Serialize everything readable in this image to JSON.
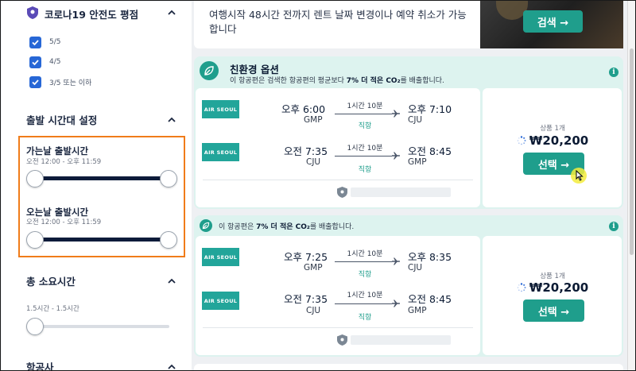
{
  "sidebar": {
    "covid_rating": {
      "title": "코로나19 안전도 평점",
      "options": [
        {
          "label": "5/5",
          "checked": true
        },
        {
          "label": "4/5",
          "checked": true
        },
        {
          "label": "3/5 또는 이하",
          "checked": true
        }
      ]
    },
    "departure_time": {
      "title": "출발 시간대 설정",
      "outbound": {
        "title": "가는날 출발시간",
        "range": "오전 12:00 - 오후 11:59"
      },
      "return": {
        "title": "오는날 출발시간",
        "range": "오전 12:00 - 오후 11:59"
      }
    },
    "duration": {
      "title": "총 소요시간",
      "range": "1.5시간 - 1.5시간"
    },
    "airline": {
      "title": "항공사"
    }
  },
  "top_card": {
    "text": "여행시작 48시간 전까지 렌트 날짜 변경이나 예약 취소가 가능합니다",
    "search_label": "검색 →"
  },
  "results": [
    {
      "eco_title": "친환경 옵션",
      "eco_desc_pre": "이 항공편은 검색한 항공편의 평균보다 ",
      "eco_desc_bold": "7% 더 적은 CO₂",
      "eco_desc_post": "를 배출합니다.",
      "legs": [
        {
          "airline": "AIR SEOUL",
          "dep_time": "오후 6:00",
          "dep_code": "GMP",
          "duration": "1시간 10분",
          "stops": "직항",
          "arr_time": "오후 7:10",
          "arr_code": "CJU"
        },
        {
          "airline": "AIR SEOUL",
          "dep_time": "오전 7:35",
          "dep_code": "CJU",
          "duration": "1시간 10분",
          "stops": "직항",
          "arr_time": "오전 8:45",
          "arr_code": "GMP"
        }
      ],
      "offer_count": "상품 1개",
      "price": "₩20,200",
      "select_label": "선택 →"
    },
    {
      "eco_desc_pre": "이 항공편은 ",
      "eco_desc_bold": "7% 더 적은 CO₂",
      "eco_desc_post": "를 배출합니다.",
      "legs": [
        {
          "airline": "AIR SEOUL",
          "dep_time": "오후 7:25",
          "dep_code": "GMP",
          "duration": "1시간 10분",
          "stops": "직항",
          "arr_time": "오후 8:35",
          "arr_code": "CJU"
        },
        {
          "airline": "AIR SEOUL",
          "dep_time": "오전 7:35",
          "dep_code": "CJU",
          "duration": "1시간 10분",
          "stops": "직항",
          "arr_time": "오전 8:45",
          "arr_code": "GMP"
        }
      ],
      "offer_count": "상품 1개",
      "price": "₩20,200",
      "select_label": "선택 →"
    }
  ],
  "colors": {
    "accent": "#1f9e8c",
    "checkbox": "#2767d6",
    "highlight_box": "#f07c1a",
    "eco_bg": "#ddf3ef",
    "airline_logo": "#22a59a"
  }
}
